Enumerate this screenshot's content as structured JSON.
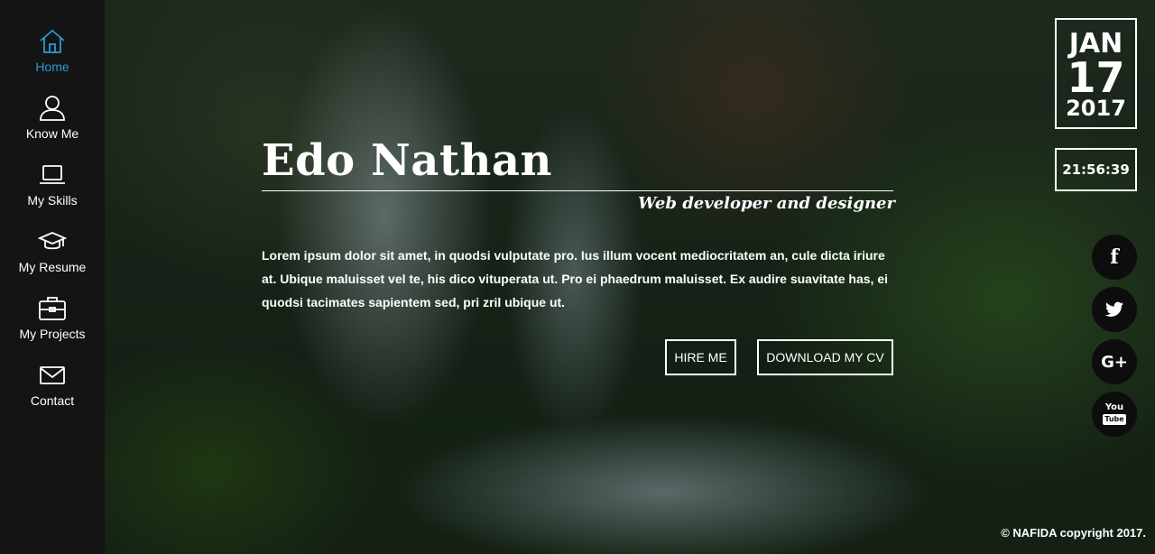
{
  "sidebar": {
    "items": [
      {
        "label": "Home",
        "icon": "home-icon",
        "active": true
      },
      {
        "label": "Know Me",
        "icon": "user-icon"
      },
      {
        "label": "My Skills",
        "icon": "laptop-icon"
      },
      {
        "label": "My Resume",
        "icon": "graduation-cap-icon"
      },
      {
        "label": "My Projects",
        "icon": "briefcase-icon"
      },
      {
        "label": "Contact",
        "icon": "envelope-icon"
      }
    ]
  },
  "hero": {
    "name": "Edo Nathan",
    "subtitle": "Web developer and designer",
    "text": "Lorem ipsum dolor sit amet, in quodsi vulputate pro. Ius illum vocent mediocritatem an, cule dicta iriure at. Ubique maluisset vel te, his dico vituperata ut. Pro ei phaedrum maluisset. Ex audire suavitate has, ei quodsi tacimates sapientem sed, pri zril ubique ut.",
    "hire_label": "HIRE ME",
    "cv_label": "DOWNLOAD MY CV"
  },
  "date": {
    "month": "JAN",
    "day": "17",
    "year": "2017"
  },
  "clock": "21:56:39",
  "social": [
    "facebook-icon",
    "twitter-icon",
    "google-plus-icon",
    "youtube-icon"
  ],
  "copyright": "© NAFIDA copyright 2017.",
  "colors": {
    "accent": "#2a9ad6",
    "sidebar": "#141414"
  }
}
